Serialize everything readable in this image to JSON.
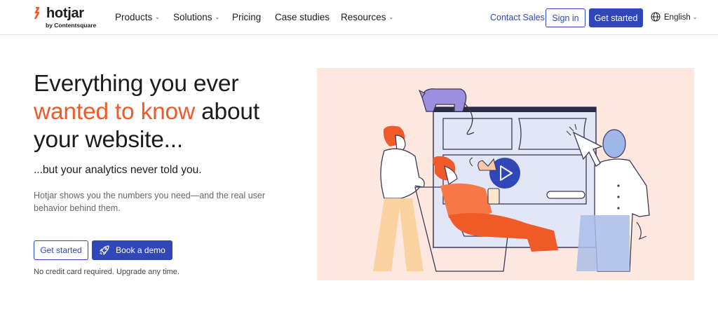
{
  "brand": {
    "name": "hotjar",
    "tagline": "by Contentsquare",
    "color": "#f05a28"
  },
  "nav": {
    "items": [
      {
        "label": "Products",
        "has_dropdown": true
      },
      {
        "label": "Solutions",
        "has_dropdown": true
      },
      {
        "label": "Pricing",
        "has_dropdown": false
      },
      {
        "label": "Case studies",
        "has_dropdown": false
      },
      {
        "label": "Resources",
        "has_dropdown": true
      }
    ],
    "contact_label": "Contact Sales",
    "signin_label": "Sign in",
    "get_started_label": "Get started",
    "language_label": "English",
    "language_icon": "globe-icon"
  },
  "hero": {
    "headline_line1": "Everything you ever",
    "headline_accent": "wanted to know",
    "headline_rest": " about your website...",
    "subhead": "...but your analytics never told you.",
    "description": "Hotjar shows you the numbers you need—and the real user behavior behind them.",
    "get_started_label": "Get started",
    "demo_label": "Book a demo",
    "demo_icon": "rocket-icon",
    "note": "No credit card required. Upgrade any time.",
    "play_icon": "play-icon"
  },
  "colors": {
    "primary": "#3147b8",
    "accent": "#f05a28",
    "illustration_bg": "#fde7df"
  }
}
